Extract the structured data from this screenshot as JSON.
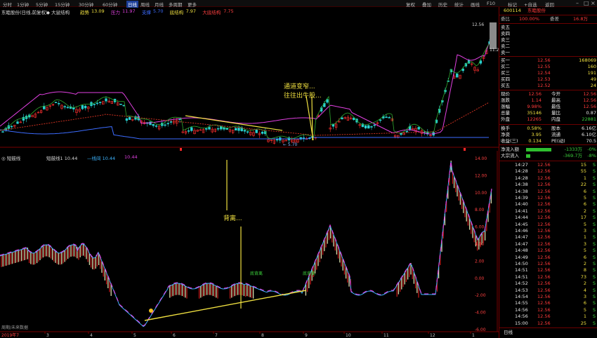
{
  "menubar": {
    "periods": [
      "分时",
      "1分钟",
      "5分钟",
      "15分钟",
      "30分钟",
      "60分钟",
      "日线",
      "周线",
      "月线",
      "多周期",
      "更多"
    ],
    "active_period": "日线",
    "right_menu": [
      "复权",
      "叠加",
      "历史",
      "统计",
      "画线",
      "F10",
      "标记",
      "+自选",
      "返回"
    ]
  },
  "header": {
    "stock_name": "东睦股份(日线,前复权)",
    "indicator_name": "◆ 大鼠结构",
    "items": [
      {
        "label": "趋势",
        "value": "13.09",
        "color": "#f0e040"
      },
      {
        "label": "压力",
        "value": "11.97",
        "color": "#e040e0"
      },
      {
        "label": "支撑",
        "value": "5.70",
        "color": "#3c6cff"
      },
      {
        "label": "底结构",
        "value": "7.97",
        "color": "#f0e040"
      },
      {
        "label": "大底结构",
        "value": "7.75",
        "color": "#ff4040"
      }
    ]
  },
  "main_chart": {
    "price_labels": {
      "high": "12.56",
      "peak": "11.20",
      "low": "5.70"
    },
    "annotation": "通道变窄...\n往往出牛股..."
  },
  "sub_chart": {
    "indicator_name": "◎ 短鼓线",
    "items": [
      {
        "label": "短鼓线1",
        "value": "10.44",
        "color": "#d8d8d8"
      },
      {
        "label": "—线间",
        "value": "10.44",
        "color": "#3cb4ff"
      },
      {
        "label": "",
        "value": "10.44",
        "color": "#e040e0"
      }
    ],
    "annotation": "背离...",
    "signal_labels": [
      "底背离",
      "底背离"
    ],
    "y_ticks": [
      "14.00",
      "12.00",
      "10.00",
      "8.00",
      "6.00",
      "4.00",
      "2.00",
      "0.00",
      "-2.00",
      "-4.00",
      "-6.00"
    ],
    "x_labels": [
      "3",
      "4",
      "5",
      "6",
      "7",
      "8",
      "9",
      "10",
      "11",
      "12",
      "1"
    ],
    "bottom_left": "2019年7",
    "hint": "周期/未来数据"
  },
  "quote": {
    "code": "600114",
    "name": "东睦股份",
    "weibi": {
      "label": "委比",
      "pct": "100.00%",
      "wc_label": "委差",
      "wc": "16.8万"
    },
    "asks": [
      {
        "label": "卖五",
        "price": "",
        "vol": ""
      },
      {
        "label": "卖四",
        "price": "",
        "vol": ""
      },
      {
        "label": "卖三",
        "price": "",
        "vol": ""
      },
      {
        "label": "卖二",
        "price": "",
        "vol": ""
      },
      {
        "label": "卖一",
        "price": "",
        "vol": ""
      }
    ],
    "bids": [
      {
        "label": "买一",
        "price": "12.56",
        "vol": "168069"
      },
      {
        "label": "买二",
        "price": "12.55",
        "vol": "160"
      },
      {
        "label": "买三",
        "price": "12.54",
        "vol": "191"
      },
      {
        "label": "买四",
        "price": "12.53",
        "vol": "49"
      },
      {
        "label": "买五",
        "price": "12.52",
        "vol": "24"
      }
    ],
    "stats": [
      {
        "l1": "现价",
        "v1": "12.56",
        "c1": "red",
        "l2": "今开",
        "v2": "12.56",
        "c2": "red"
      },
      {
        "l1": "涨跌",
        "v1": "1.14",
        "c1": "red",
        "l2": "最高",
        "v2": "12.56",
        "c2": "red"
      },
      {
        "l1": "涨幅",
        "v1": "9.98%",
        "c1": "red",
        "l2": "最低",
        "v2": "12.56",
        "c2": "red"
      },
      {
        "l1": "总量",
        "v1": "35146",
        "c1": "yel",
        "l2": "量比",
        "v2": "0.87",
        "c2": "wht"
      },
      {
        "l1": "外盘",
        "v1": "12265",
        "c1": "red",
        "l2": "内盘",
        "v2": "22881",
        "c2": "green"
      }
    ],
    "stats2": [
      {
        "l1": "换手",
        "v1": "0.58%",
        "l2": "股本",
        "v2": "6.16亿"
      },
      {
        "l1": "净资",
        "v1": "3.95",
        "l2": "流通",
        "v2": "6.10亿"
      },
      {
        "l1": "收益(三)",
        "v1": "0.134",
        "l2": "PE(动)",
        "v2": "70.5"
      }
    ],
    "flows": [
      {
        "label": "净流入额",
        "value": "-1333万",
        "pct": "-0%"
      },
      {
        "label": "大宗流入",
        "value": "-369.7万",
        "pct": "-8%"
      }
    ],
    "ticks": [
      {
        "t": "14:27",
        "p": "12.56",
        "v": "15",
        "d": "S"
      },
      {
        "t": "14:28",
        "p": "12.56",
        "v": "55",
        "d": "S"
      },
      {
        "t": "14:28",
        "p": "12.56",
        "v": "1",
        "d": "S"
      },
      {
        "t": "14:38",
        "p": "12.56",
        "v": "22",
        "d": "S"
      },
      {
        "t": "14:38",
        "p": "12.56",
        "v": "6",
        "d": "S"
      },
      {
        "t": "14:39",
        "p": "12.56",
        "v": "5",
        "d": "S"
      },
      {
        "t": "14:40",
        "p": "12.56",
        "v": "6",
        "d": "S"
      },
      {
        "t": "14:41",
        "p": "12.56",
        "v": "2",
        "d": "S"
      },
      {
        "t": "14:44",
        "p": "12.56",
        "v": "17",
        "d": "S"
      },
      {
        "t": "14:45",
        "p": "12.56",
        "v": "5",
        "d": "S"
      },
      {
        "t": "14:46",
        "p": "12.56",
        "v": "3",
        "d": "S"
      },
      {
        "t": "14:47",
        "p": "12.56",
        "v": "1",
        "d": "S"
      },
      {
        "t": "14:47",
        "p": "12.56",
        "v": "3",
        "d": "S"
      },
      {
        "t": "14:48",
        "p": "12.56",
        "v": "5",
        "d": "S"
      },
      {
        "t": "14:49",
        "p": "12.56",
        "v": "6",
        "d": "S"
      },
      {
        "t": "14:50",
        "p": "12.56",
        "v": "2",
        "d": "S"
      },
      {
        "t": "14:51",
        "p": "12.56",
        "v": "8",
        "d": "S"
      },
      {
        "t": "14:51",
        "p": "12.56",
        "v": "73",
        "d": "S"
      },
      {
        "t": "14:52",
        "p": "12.56",
        "v": "2",
        "d": "S"
      },
      {
        "t": "14:53",
        "p": "12.56",
        "v": "4",
        "d": "S"
      },
      {
        "t": "14:54",
        "p": "12.56",
        "v": "3",
        "d": "S"
      },
      {
        "t": "14:55",
        "p": "12.56",
        "v": "6",
        "d": "S"
      },
      {
        "t": "14:56",
        "p": "12.56",
        "v": "5",
        "d": "S"
      },
      {
        "t": "14:56",
        "p": "12.56",
        "v": "1",
        "d": "S"
      },
      {
        "t": "15:00",
        "p": "12.56",
        "v": "25",
        "d": "S"
      }
    ],
    "bottom_label": "日线"
  }
}
